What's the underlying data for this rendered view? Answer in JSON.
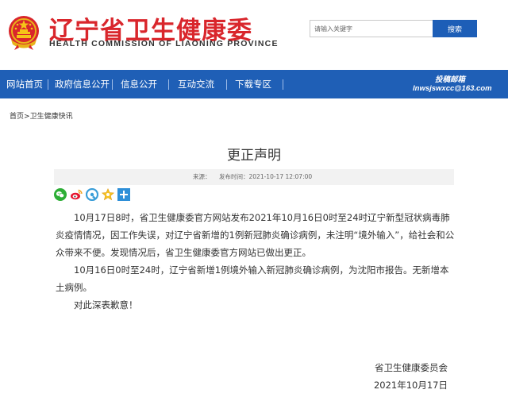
{
  "header": {
    "title_cn": "辽宁省卫生健康委",
    "title_en": "HEALTH COMMISSION OF LIAONING PROVINCE",
    "emblem_icon": "national-emblem-icon",
    "search_placeholder": "请输入关键字",
    "search_button": "搜索"
  },
  "nav": {
    "items": [
      {
        "label": "网站首页"
      },
      {
        "label": "政府信息公开"
      },
      {
        "label": "信息公开"
      },
      {
        "label": "互动交流"
      },
      {
        "label": "下载专区"
      }
    ],
    "mailbox_label": "投稿邮箱",
    "mailbox_address": "lnwsjswxcc@163.com"
  },
  "breadcrumb": {
    "home": "首页",
    "separator": ">",
    "current": "卫生健康快讯"
  },
  "article": {
    "title": "更正声明",
    "source_label": "来源：",
    "date_label": "发布时间：2021-10-17 12:07:00",
    "share_icons": [
      "wechat-icon",
      "weibo-icon",
      "qzone-icon",
      "favorite-star-icon",
      "more-plus-icon"
    ],
    "paragraphs": [
      "10月17日8时，省卫生健康委官方网站发布2021年10月16日0时至24时辽宁新型冠状病毒肺炎疫情情况，因工作失误，对辽宁省新增的1例新冠肺炎确诊病例，未注明“境外输入”，给社会和公众带来不便。发现情况后，省卫生健康委官方网站已做出更正。",
      "10月16日0时至24时，辽宁省新增1例境外输入新冠肺炎确诊病例，为沈阳市报告。无新增本土病例。",
      "对此深表歉意！"
    ],
    "signature": "省卫生健康委员会",
    "signature_date": "2021年10月17日"
  },
  "colors": {
    "brand_red": "#d9262c",
    "nav_blue": "#1f5fb6",
    "search_blue": "#1d5eb7"
  }
}
